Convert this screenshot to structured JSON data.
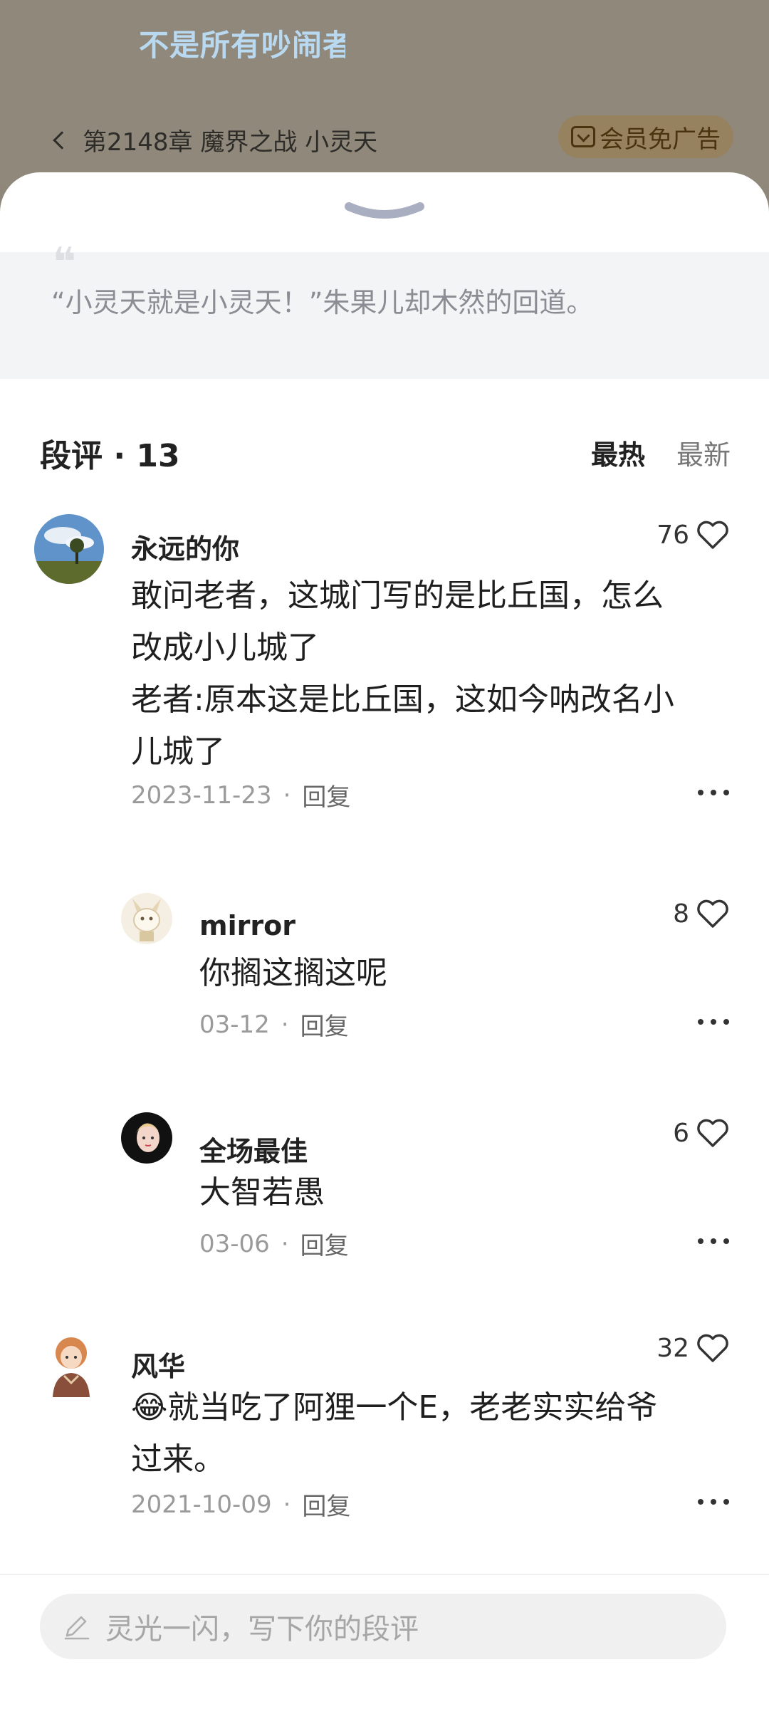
{
  "background": {
    "banner_text": "不是所有吵闹者",
    "chapter_title": "第2148章 魔界之战 小灵天",
    "vip_label": "会员免广告"
  },
  "quote": {
    "text": "“小灵天就是小灵天！”朱果儿却木然的回道。"
  },
  "section": {
    "title": "段评 · 13",
    "sort_hot": "最热",
    "sort_new": "最新"
  },
  "comments": [
    {
      "user": "永远的你",
      "likes": "76",
      "lines": [
        "敢问老者，这城门写的是比丘国，怎么",
        "改成小儿城了",
        "老者:原本这是比丘国，这如今呐改名小",
        "儿城了"
      ],
      "date": "2023-11-23",
      "dot": "·",
      "reply": "回复"
    },
    {
      "user": "mirror",
      "likes": "8",
      "lines": [
        "你搁这搁这呢"
      ],
      "date": "03-12",
      "dot": "·",
      "reply": "回复"
    },
    {
      "user": "全场最佳",
      "likes": "6",
      "lines": [
        "大智若愚"
      ],
      "date": "03-06",
      "dot": "·",
      "reply": "回复"
    },
    {
      "user": "风华",
      "likes": "32",
      "emoji": "😂",
      "lines": [
        "就当吃了阿狸一个E，老老实实给爷",
        "过来。"
      ],
      "date": "2021-10-09",
      "dot": "·",
      "reply": "回复"
    }
  ],
  "composer": {
    "placeholder": "灵光一闪，写下你的段评",
    "icon": "pencil-icon"
  },
  "colors": {
    "sheet_bg": "#ffffff",
    "quote_bg": "#f3f4f6",
    "overlay_bg": "#8f887b",
    "muted_text": "#9a9a9a"
  }
}
